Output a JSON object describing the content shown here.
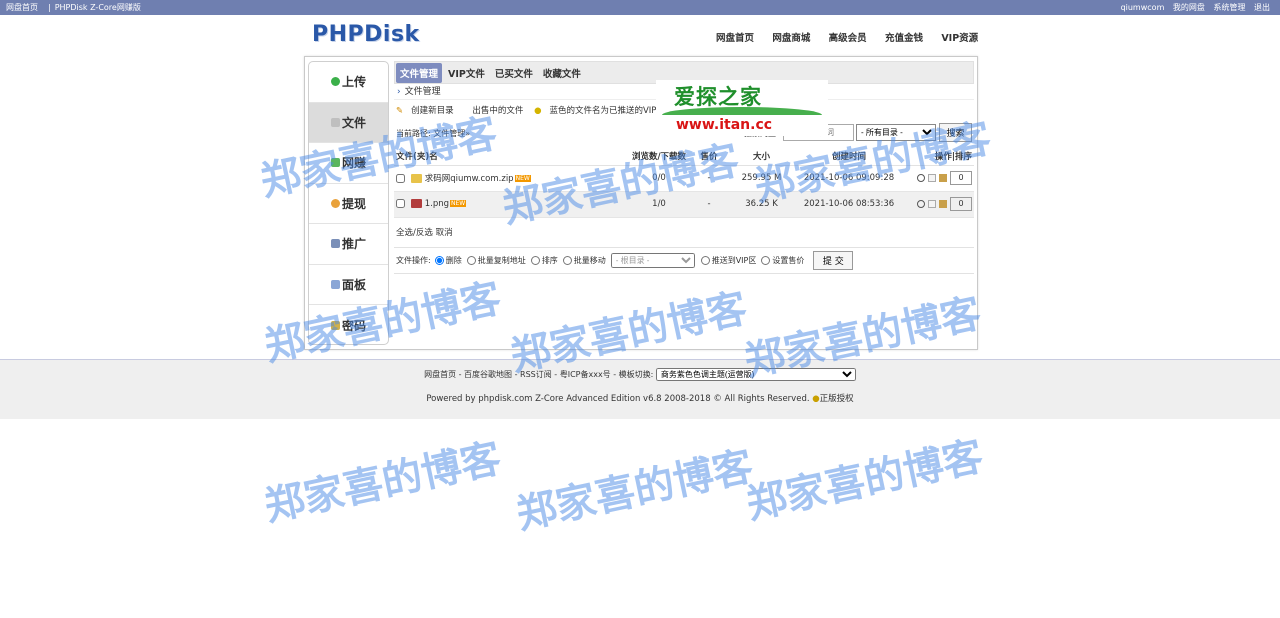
{
  "topbar": {
    "left_home": "网盘首页",
    "left_sep": "|",
    "left_title": "PHPDisk Z-Core网赚版",
    "right_user": "qiumwcom",
    "right_mydisk": "我的网盘",
    "right_admin": "系统管理",
    "right_logout": "退出"
  },
  "header": {
    "logo": "PHPDisk",
    "nav": [
      "网盘首页",
      "网盘商城",
      "高级会员",
      "充值金钱",
      "VIP资源"
    ]
  },
  "sidebar": {
    "items": [
      {
        "label": "上传",
        "icon": "upload-icon"
      },
      {
        "label": "文件",
        "icon": "file-icon"
      },
      {
        "label": "网赚",
        "icon": "earn-icon"
      },
      {
        "label": "提现",
        "icon": "withdraw-icon"
      },
      {
        "label": "推广",
        "icon": "promote-icon"
      },
      {
        "label": "面板",
        "icon": "panel-icon"
      },
      {
        "label": "密码",
        "icon": "key-icon"
      }
    ]
  },
  "tabs": [
    "文件管理",
    "VIP文件",
    "已买文件",
    "收藏文件"
  ],
  "crumb": "文件管理",
  "actions": {
    "create_dir": "创建新目录",
    "on_sale": "出售中的文件",
    "tip": "蓝色的文件名为已推送的VIP"
  },
  "search": {
    "path_label": "当前路径: 文件管理»",
    "label": "搜索网盘:",
    "placeholder": "请输入关键词",
    "select_value": "- 所有目录 -",
    "button": "搜索"
  },
  "table": {
    "headers": {
      "name": "文件(夹)名",
      "views": "浏览数/下载数",
      "price": "售价",
      "size": "大小",
      "time": "创建时间",
      "ops": "操作|排序"
    },
    "rows": [
      {
        "name": "求码网qiumw.com.zip",
        "badge": "NEW",
        "views": "0/0",
        "price": "-",
        "size": "259.95 M",
        "time": "2021-10-06 09:09:28",
        "order": "0"
      },
      {
        "name": "1.png",
        "badge": "NEW",
        "views": "1/0",
        "price": "-",
        "size": "36.25 K",
        "time": "2021-10-06 08:53:36",
        "order": "0"
      }
    ]
  },
  "select_all": "全选/反选 取消",
  "ops": {
    "label": "文件操作:",
    "delete": "删除",
    "copy_addr": "批量复制地址",
    "sort": "排序",
    "move": "批量移动",
    "root": "- 根目录 -",
    "push_vip": "推送到VIP区",
    "set_price": "设置售价",
    "submit": "提 交"
  },
  "footer": {
    "links": "网盘首页 - 百度谷歌地图 - RSS订阅 - 粤ICP备xxx号 - 模板切换:",
    "theme": "商务紫色色调主题(运营版)",
    "powered": "Powered by phpdisk.com Z-Core Advanced Edition v6.8 2008-2018 © All Rights Reserved.",
    "license": "正版授权"
  },
  "ad": {
    "cn": "爱探之家",
    "url": "www.itan.cc"
  },
  "watermark": "郑家喜的博客"
}
